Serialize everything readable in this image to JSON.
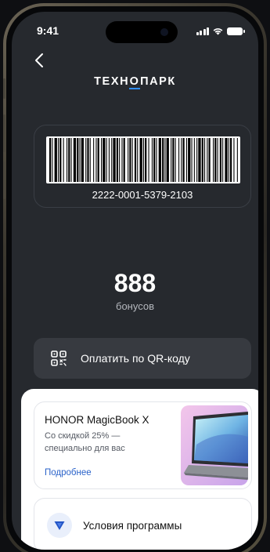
{
  "status_bar": {
    "time": "9:41"
  },
  "header": {
    "logo": "ТЕХНОПАРК",
    "back_icon": "chevron-left-icon"
  },
  "card": {
    "barcode_number": "2222-0001-5379-2103"
  },
  "bonuses": {
    "value": "888",
    "label": "бонусов"
  },
  "pay_button": {
    "label": "Оплатить по QR-коду",
    "icon": "qr-code-icon"
  },
  "promo": {
    "title": "HONOR MagicBook X",
    "subtitle": "Со скидкой 25% — специально для вас",
    "link": "Подробнее"
  },
  "program": {
    "label": "Условия программы",
    "icon": "shield-icon"
  },
  "colors": {
    "background": "#26292e",
    "card_border": "#3a3e45",
    "button": "#373a40",
    "link": "#2a62c9",
    "logo_accent": "#2f8dff"
  }
}
